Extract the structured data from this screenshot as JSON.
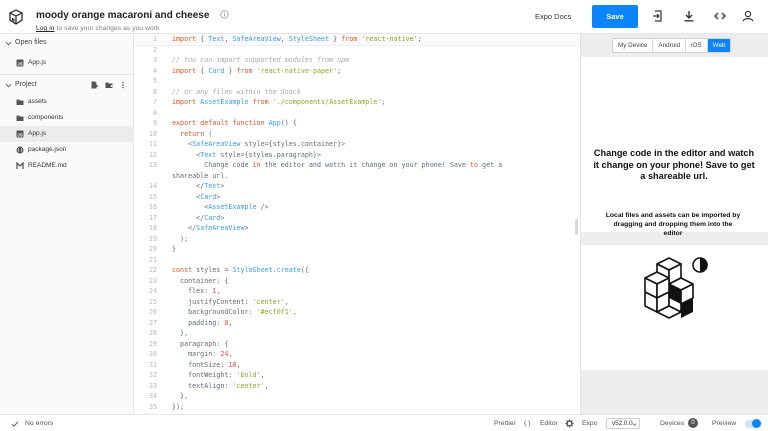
{
  "header": {
    "title": "moody orange macaroni and cheese",
    "login_link": "Log in",
    "login_suffix": " to save your changes as you work",
    "expo_docs": "Expo Docs",
    "save": "Save"
  },
  "sidebar": {
    "open_files_label": "Open files",
    "open_files": [
      {
        "name": "App.js"
      }
    ],
    "project_label": "Project",
    "items": [
      {
        "name": "assets",
        "kind": "folder"
      },
      {
        "name": "components",
        "kind": "folder"
      },
      {
        "name": "App.js",
        "kind": "js",
        "active": true
      },
      {
        "name": "package.json",
        "kind": "json"
      },
      {
        "name": "README.md",
        "kind": "md"
      }
    ]
  },
  "editor": {
    "lines": [
      {
        "n": "1",
        "html": "<span class='kw'>import</span> { <span class='fn'>Text</span>, <span class='fn'>SafeAreaView</span>, <span class='fn'>StyleSheet</span> } <span class='kw'>from</span> <span class='st'>'react-native'</span>;"
      },
      {
        "n": "2",
        "html": ""
      },
      {
        "n": "3",
        "html": "<span class='cm'>// You can import supported modules from npm</span>"
      },
      {
        "n": "4",
        "html": "<span class='kw'>import</span> { <span class='fn'>Card</span> } <span class='kw'>from</span> <span class='st'>'react-native-paper'</span>;"
      },
      {
        "n": "5",
        "html": ""
      },
      {
        "n": "6",
        "html": "<span class='cm'>// or any files within the Snack</span>"
      },
      {
        "n": "7",
        "html": "<span class='kw'>import</span> <span class='fn'>AssetExample</span> <span class='kw'>from</span> <span class='st'>'./components/AssetExample'</span>;"
      },
      {
        "n": "8",
        "html": ""
      },
      {
        "n": "9",
        "html": "<span class='kw'>export default function</span> <span class='fn'>App</span>() {"
      },
      {
        "n": "10",
        "html": "  <span class='kw'>return</span> ("
      },
      {
        "n": "11",
        "html": "    &lt;<span class='fn'>SafeAreaView</span> style={styles.container}&gt;"
      },
      {
        "n": "12",
        "html": "      &lt;<span class='fn'>Text</span> style={styles.paragraph}&gt;"
      },
      {
        "n": "13",
        "html": "        Change code <span class='kw'>in</span> the editor and watch it change on your phone! Save <span class='kw'>to</span> get a"
      },
      {
        "n": "",
        "html": "shareable url."
      },
      {
        "n": "14",
        "html": "      &lt;/<span class='fn'>Text</span>&gt;"
      },
      {
        "n": "15",
        "html": "      &lt;<span class='fn'>Card</span>&gt;"
      },
      {
        "n": "16",
        "html": "        &lt;<span class='fn'>AssetExample</span> /&gt;"
      },
      {
        "n": "17",
        "html": "      &lt;/<span class='fn'>Card</span>&gt;"
      },
      {
        "n": "18",
        "html": "    &lt;/<span class='fn'>SafeAreaView</span>&gt;"
      },
      {
        "n": "19",
        "html": "  );"
      },
      {
        "n": "20",
        "html": "}"
      },
      {
        "n": "21",
        "html": ""
      },
      {
        "n": "22",
        "html": "<span class='kw'>const</span> styles = <span class='fn'>StyleSheet</span>.<span class='fn'>create</span>({"
      },
      {
        "n": "23",
        "html": "  container: {"
      },
      {
        "n": "24",
        "html": "    flex: <span class='nm'>1</span>,"
      },
      {
        "n": "25",
        "html": "    justifyContent: <span class='st'>'center'</span>,"
      },
      {
        "n": "26",
        "html": "    backgroundColor: <span class='st'>'#ecf0f1'</span>,"
      },
      {
        "n": "27",
        "html": "    padding: <span class='nm'>8</span>,"
      },
      {
        "n": "28",
        "html": "  },"
      },
      {
        "n": "29",
        "html": "  paragraph: {"
      },
      {
        "n": "30",
        "html": "    margin: <span class='nm'>24</span>,"
      },
      {
        "n": "31",
        "html": "    fontSize: <span class='nm'>18</span>,"
      },
      {
        "n": "32",
        "html": "    fontWeight: <span class='st'>'bold'</span>,"
      },
      {
        "n": "33",
        "html": "    textAlign: <span class='st'>'center'</span>,"
      },
      {
        "n": "34",
        "html": "  },"
      },
      {
        "n": "35",
        "html": "});"
      }
    ]
  },
  "preview": {
    "tabs": [
      {
        "label": "My Device",
        "active": false
      },
      {
        "label": "Android",
        "active": false
      },
      {
        "label": "iOS",
        "active": false
      },
      {
        "label": "Web",
        "active": true
      }
    ],
    "message": "Change code in the editor and watch it change on your phone! Save to get a shareable url.",
    "card_text": "Local files and assets can be imported by dragging and dropping them into the editor"
  },
  "footer": {
    "errors": "No errors",
    "prettier": "Prettier",
    "prettier_icon": "{ }",
    "editor": "Editor",
    "expo": "Expo",
    "sdk_version": "v52.0.0",
    "devices": "Devices",
    "devices_count": "0",
    "preview": "Preview"
  },
  "colors": {
    "accent": "#0a84ff",
    "keyword": "#d2572a",
    "string": "#89a82a",
    "function": "#3a9ce0"
  }
}
